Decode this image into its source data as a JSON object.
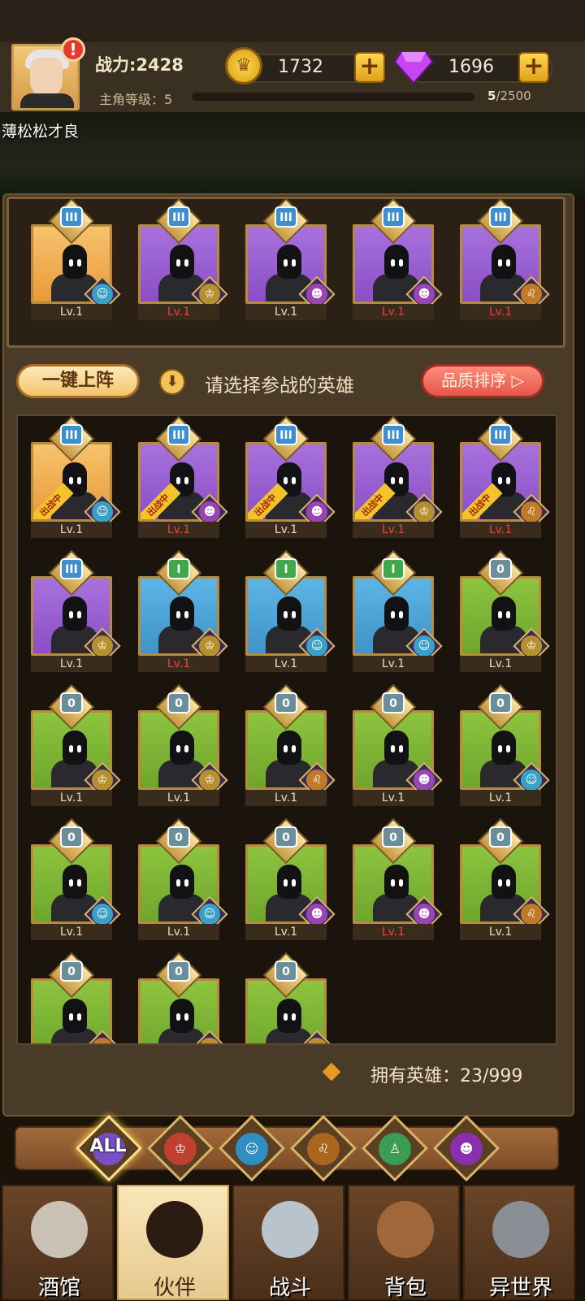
{
  "header": {
    "power": "战力:2428",
    "gold": "1732",
    "gems": "1696",
    "level_label": "主角等级：5",
    "exp_current": "5",
    "exp_total": "/2500",
    "player_name": "薄松松才良",
    "alert": "!"
  },
  "team": [
    {
      "rank": "III",
      "bg": "orange",
      "cls": "elf",
      "lv": "Lv.1",
      "red": false
    },
    {
      "rank": "III",
      "bg": "purple",
      "cls": "human",
      "lv": "Lv.1",
      "red": true
    },
    {
      "rank": "III",
      "bg": "purple",
      "cls": "orc",
      "lv": "Lv.1",
      "red": false
    },
    {
      "rank": "III",
      "bg": "purple",
      "cls": "orc",
      "lv": "Lv.1",
      "red": true
    },
    {
      "rank": "III",
      "bg": "purple",
      "cls": "lion",
      "lv": "Lv.1",
      "red": true
    }
  ],
  "controls": {
    "auto_deploy": "一键上阵",
    "hint": "请选择参战的英雄",
    "sort": "品质排序 ▷"
  },
  "deployed_label": "出战中",
  "heroes": [
    {
      "rank": "III",
      "bg": "orange",
      "cls": "elf",
      "lv": "Lv.1",
      "red": false,
      "deployed": true
    },
    {
      "rank": "III",
      "bg": "purple",
      "cls": "orc",
      "lv": "Lv.1",
      "red": true,
      "deployed": true
    },
    {
      "rank": "III",
      "bg": "purple",
      "cls": "orc",
      "lv": "Lv.1",
      "red": false,
      "deployed": true
    },
    {
      "rank": "III",
      "bg": "purple",
      "cls": "human",
      "lv": "Lv.1",
      "red": true,
      "deployed": true
    },
    {
      "rank": "III",
      "bg": "purple",
      "cls": "lion",
      "lv": "Lv.1",
      "red": true,
      "deployed": true
    },
    {
      "rank": "III",
      "bg": "purple",
      "cls": "human",
      "lv": "Lv.1",
      "red": false,
      "deployed": false
    },
    {
      "rank": "I",
      "bg": "blue",
      "cls": "human",
      "lv": "Lv.1",
      "red": true,
      "deployed": false
    },
    {
      "rank": "I",
      "bg": "blue",
      "cls": "elf",
      "lv": "Lv.1",
      "red": false,
      "deployed": false
    },
    {
      "rank": "I",
      "bg": "blue",
      "cls": "elf",
      "lv": "Lv.1",
      "red": false,
      "deployed": false
    },
    {
      "rank": "0",
      "bg": "green",
      "cls": "human",
      "lv": "Lv.1",
      "red": false,
      "deployed": false
    },
    {
      "rank": "0",
      "bg": "green",
      "cls": "human",
      "lv": "Lv.1",
      "red": false,
      "deployed": false
    },
    {
      "rank": "0",
      "bg": "green",
      "cls": "human",
      "lv": "Lv.1",
      "red": false,
      "deployed": false
    },
    {
      "rank": "0",
      "bg": "green",
      "cls": "lion",
      "lv": "Lv.1",
      "red": false,
      "deployed": false
    },
    {
      "rank": "0",
      "bg": "green",
      "cls": "orc",
      "lv": "Lv.1",
      "red": false,
      "deployed": false
    },
    {
      "rank": "0",
      "bg": "green",
      "cls": "elf",
      "lv": "Lv.1",
      "red": false,
      "deployed": false
    },
    {
      "rank": "0",
      "bg": "green",
      "cls": "elf",
      "lv": "Lv.1",
      "red": false,
      "deployed": false
    },
    {
      "rank": "0",
      "bg": "green",
      "cls": "elf",
      "lv": "Lv.1",
      "red": false,
      "deployed": false
    },
    {
      "rank": "0",
      "bg": "green",
      "cls": "orc",
      "lv": "Lv.1",
      "red": false,
      "deployed": false
    },
    {
      "rank": "0",
      "bg": "green",
      "cls": "orc",
      "lv": "Lv.1",
      "red": true,
      "deployed": false
    },
    {
      "rank": "0",
      "bg": "green",
      "cls": "lion",
      "lv": "Lv.1",
      "red": false,
      "deployed": false
    },
    {
      "rank": "0",
      "bg": "green",
      "cls": "lion",
      "lv": "",
      "red": false,
      "deployed": false
    },
    {
      "rank": "0",
      "bg": "green",
      "cls": "human",
      "lv": "",
      "red": false,
      "deployed": false
    },
    {
      "rank": "0",
      "bg": "green",
      "cls": "human",
      "lv": "",
      "red": false,
      "deployed": false
    }
  ],
  "owned": "拥有英雄：23/999",
  "filters": [
    {
      "name": "all",
      "label": "ALL"
    },
    {
      "name": "human",
      "label": ""
    },
    {
      "name": "elf",
      "label": ""
    },
    {
      "name": "lion",
      "label": ""
    },
    {
      "name": "dwarf",
      "label": ""
    },
    {
      "name": "orc",
      "label": ""
    }
  ],
  "tabs": [
    {
      "name": "tavern",
      "label": "酒馆",
      "active": false
    },
    {
      "name": "partner",
      "label": "伙伴",
      "active": true
    },
    {
      "name": "battle",
      "label": "战斗",
      "active": false
    },
    {
      "name": "bag",
      "label": "背包",
      "active": false
    },
    {
      "name": "otherworld",
      "label": "异世界",
      "active": false
    }
  ],
  "colors": {
    "gold": "#e0a21c",
    "purple_gem": "#b23cf0",
    "accent_red": "#e4463b"
  }
}
